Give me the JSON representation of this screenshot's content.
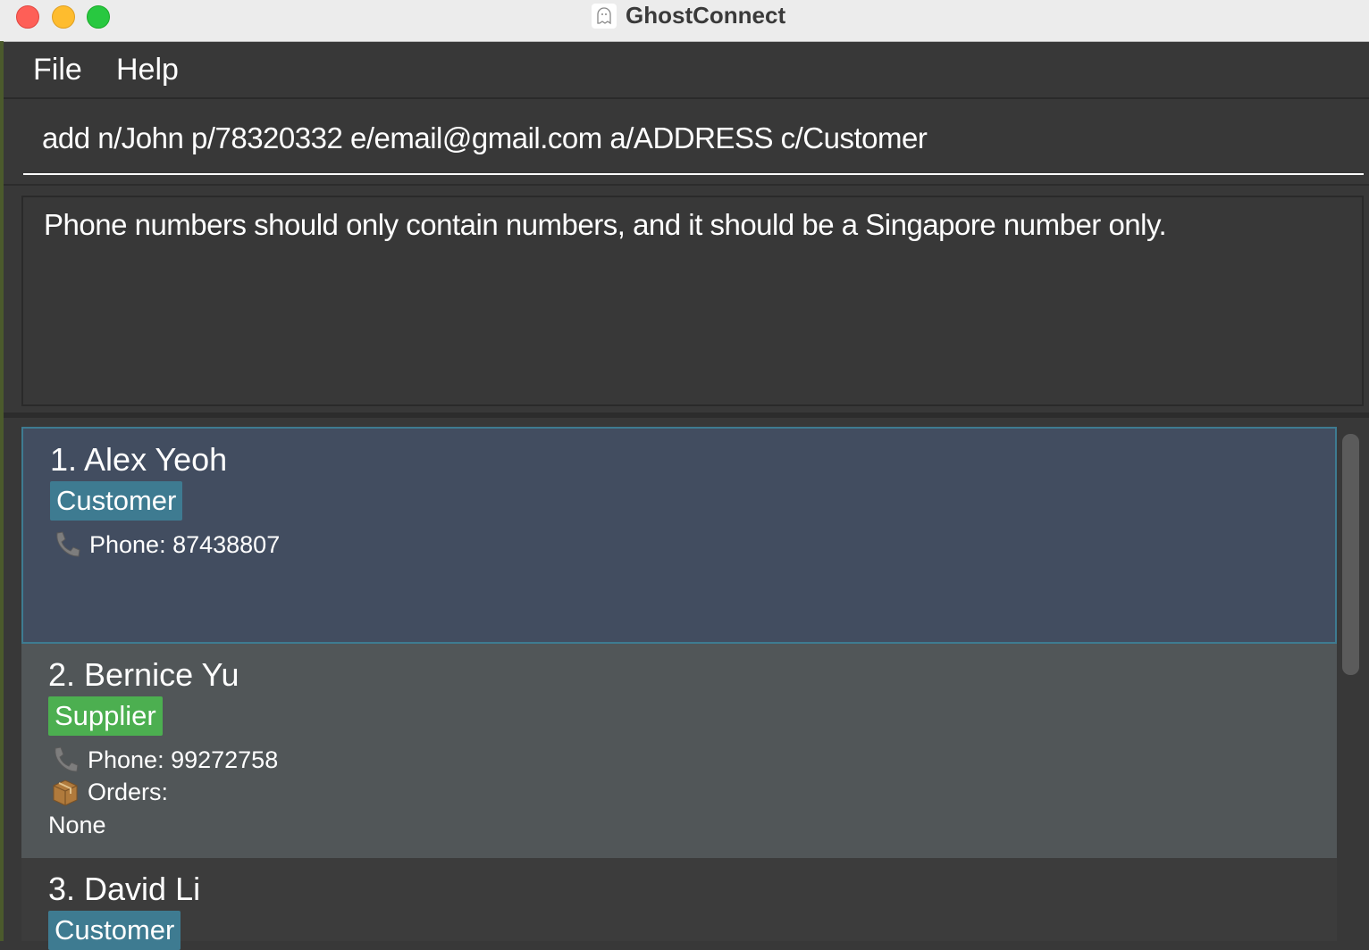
{
  "window": {
    "title": "GhostConnect"
  },
  "menu": {
    "file": "File",
    "help": "Help"
  },
  "command": {
    "value": "add n/John p/78320332 e/email@gmail.com a/ADDRESS c/Customer"
  },
  "result": {
    "message": "Phone numbers should only contain numbers, and it should be a Singapore number only."
  },
  "contacts": [
    {
      "name": "1. Alex Yeoh",
      "tag": "Customer",
      "phone": "Phone: 87438807"
    },
    {
      "name": "2. Bernice Yu",
      "tag": "Supplier",
      "phone": "Phone: 99272758",
      "orders_label": "Orders:",
      "orders_value": "None"
    },
    {
      "name": "3. David Li",
      "tag": "Customer"
    }
  ],
  "colors": {
    "customer_tag": "#3e7b91",
    "supplier_tag": "#4caf50",
    "selected_card": "#424d60"
  },
  "icons": {
    "phone": "phone-icon",
    "orders": "package-icon",
    "app": "ghost-icon"
  }
}
